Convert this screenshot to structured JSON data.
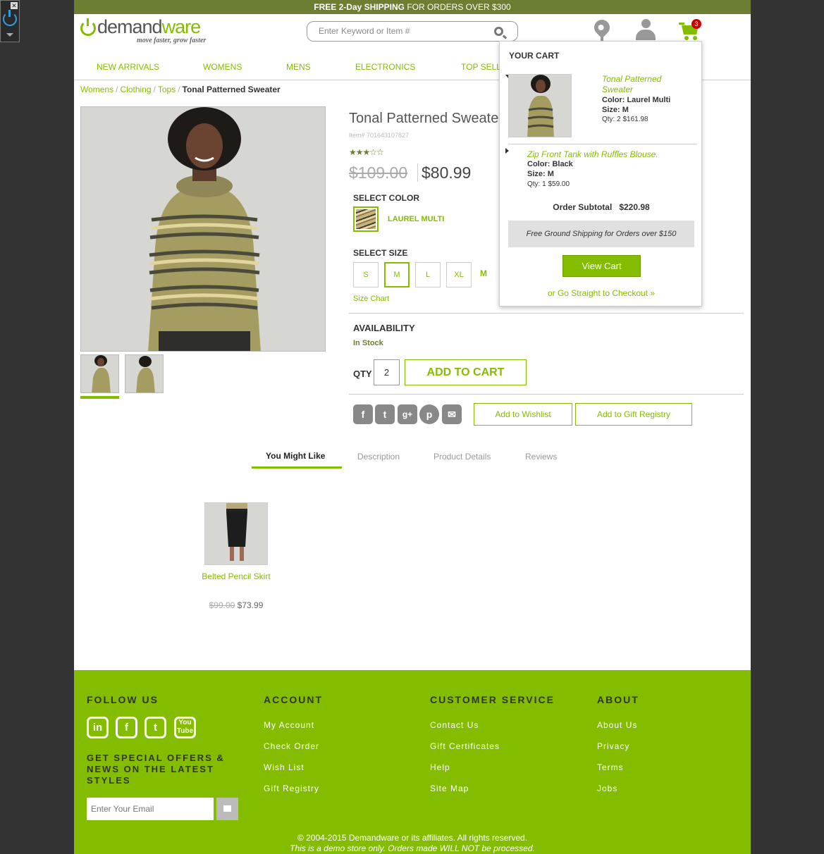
{
  "promo": {
    "bold": "FREE 2-Day SHIPPING",
    "rest": " FOR ORDERS OVER $300"
  },
  "brand": {
    "name_a": "demand",
    "name_b": "ware",
    "tagline": "move faster, grow faster"
  },
  "search": {
    "placeholder": "Enter Keyword or Item #"
  },
  "header": {
    "cart_count": "3"
  },
  "nav": [
    "NEW ARRIVALS",
    "WOMENS",
    "MENS",
    "ELECTRONICS",
    "TOP SELL"
  ],
  "breadcrumb": {
    "items": [
      "Womens",
      "Clothing",
      "Tops"
    ],
    "separator": "/",
    "current": "Tonal Patterned Sweater"
  },
  "product": {
    "title": "Tonal Patterned Sweate",
    "item_no": "Item# 701643107827",
    "rating_stars": "★★★☆☆",
    "old_price": "$109.00",
    "price": "$80.99",
    "select_color_label": "SELECT COLOR",
    "color_name": "LAUREL MULTI",
    "select_size_label": "SELECT SIZE",
    "sizes": [
      "S",
      "M",
      "L",
      "XL"
    ],
    "selected_size": "M",
    "size_chart": "Size Chart",
    "availability_label": "AVAILABILITY",
    "stock": "In Stock",
    "qty_label": "QTY",
    "qty_value": "2",
    "add_to_cart": "ADD TO CART",
    "wishlist": "Add to Wishlist",
    "registry": "Add to Gift Registry"
  },
  "tabs": [
    "You Might Like",
    "Description",
    "Product Details",
    "Reviews"
  ],
  "recommendation": {
    "name": "Belted Pencil Skirt",
    "old_price": "$99.00",
    "price": "$73.99"
  },
  "mini_cart": {
    "title": "YOUR CART",
    "items": [
      {
        "name": "Tonal Patterned Sweater",
        "color": "Color: Laurel Multi",
        "size": "Size: M",
        "qty": "Qty: 2 $161.98"
      },
      {
        "name": "Zip Front Tank with Ruffles Blouse.",
        "color": "Color: Black",
        "size": "Size: M",
        "qty": "Qty: 1 $59.00"
      }
    ],
    "subtotal_label": "Order Subtotal",
    "subtotal_value": "$220.98",
    "shipping_note": "Free Ground Shipping for Orders over $150",
    "view_cart": "View Cart",
    "checkout": "or Go Straight to Checkout »"
  },
  "footer": {
    "follow_us": "FOLLOW US",
    "offers": "GET SPECIAL OFFERS & NEWS ON THE LATEST STYLES",
    "email_placeholder": "Enter Your Email",
    "account": {
      "heading": "ACCOUNT",
      "links": [
        "My Account",
        "Check Order",
        "Wish List",
        "Gift Registry"
      ]
    },
    "customer_service": {
      "heading": "CUSTOMER SERVICE",
      "links": [
        "Contact Us",
        "Gift Certificates",
        "Help",
        "Site Map"
      ]
    },
    "about": {
      "heading": "ABOUT",
      "links": [
        "About Us",
        "Privacy",
        "Terms",
        "Jobs"
      ]
    },
    "copyright": "© 2004-2015 Demandware or its affiliates. All rights reserved.",
    "demo_note": "This is a demo store only. Orders made WILL NOT be processed."
  },
  "colors": {
    "accent": "#84bd00",
    "promo_bar": "#6b7e32",
    "badge": "#cc0000"
  }
}
